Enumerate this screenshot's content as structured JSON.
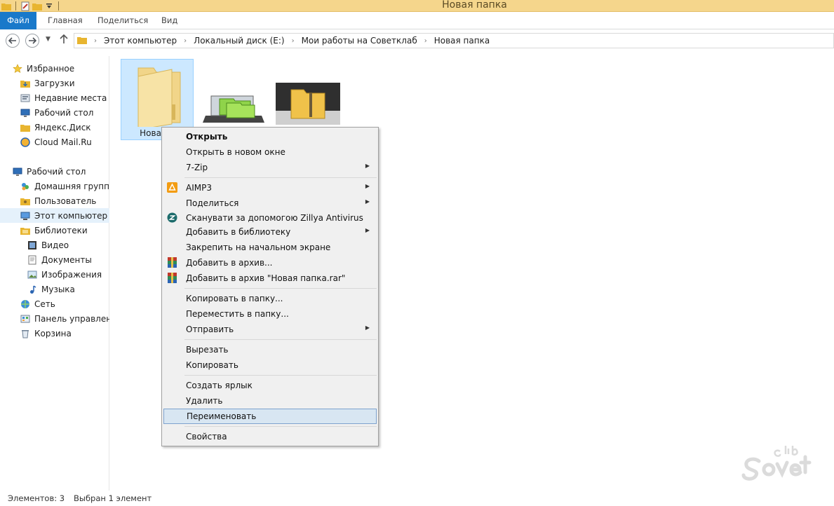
{
  "window": {
    "title": "Новая папка"
  },
  "quick_access": {
    "icons": [
      "folder-icon",
      "properties-icon",
      "new-folder-icon",
      "customize-dropdown-icon"
    ]
  },
  "ribbon": {
    "tabs": [
      "Файл",
      "Главная",
      "Поделиться",
      "Вид"
    ]
  },
  "address_bar": {
    "breadcrumbs": [
      "Этот компьютер",
      "Локальный диск (E:)",
      "Мои работы на Советклаб",
      "Новая папка"
    ]
  },
  "nav_pane": {
    "items": [
      {
        "label": "Избранное",
        "icon": "star-icon"
      },
      {
        "label": "Загрузки",
        "icon": "downloads-icon"
      },
      {
        "label": "Недавние места",
        "icon": "recent-places-icon"
      },
      {
        "label": "Рабочий стол",
        "icon": "desktop-icon"
      },
      {
        "label": "Яндекс.Диск",
        "icon": "yandex-disk-icon"
      },
      {
        "label": "Cloud Mail.Ru",
        "icon": "cloud-mail-icon"
      },
      {
        "label": "Рабочий стол",
        "icon": "desktop-icon"
      },
      {
        "label": "Домашняя группа",
        "icon": "homegroup-icon"
      },
      {
        "label": "Пользователь",
        "icon": "user-folder-icon"
      },
      {
        "label": "Этот компьютер",
        "icon": "computer-icon"
      },
      {
        "label": "Библиотеки",
        "icon": "libraries-icon"
      },
      {
        "label": "Видео",
        "icon": "video-icon"
      },
      {
        "label": "Документы",
        "icon": "documents-icon"
      },
      {
        "label": "Изображения",
        "icon": "pictures-icon"
      },
      {
        "label": "Музыка",
        "icon": "music-icon"
      },
      {
        "label": "Сеть",
        "icon": "network-icon"
      },
      {
        "label": "Панель управления",
        "icon": "control-panel-icon"
      },
      {
        "label": "Корзина",
        "icon": "recycle-bin-icon"
      }
    ]
  },
  "content": {
    "items": [
      {
        "label": "Новая п",
        "kind": "folder",
        "selected": true
      },
      {
        "label": "",
        "kind": "image-thumbnail"
      },
      {
        "label": "",
        "kind": "image-thumbnail"
      }
    ]
  },
  "context_menu": {
    "items": [
      {
        "label": "Открыть",
        "bold": true
      },
      {
        "label": "Открыть в новом окне"
      },
      {
        "label": "7-Zip",
        "submenu": true
      },
      {
        "label": "AIMP3",
        "submenu": true,
        "icon": "aimp-icon"
      },
      {
        "label": "Поделиться",
        "submenu": true
      },
      {
        "label": "Сканувати за допомогою Zillya Antivirus",
        "icon": "zillya-icon"
      },
      {
        "label": "Добавить в библиотеку",
        "submenu": true
      },
      {
        "label": "Закрепить на начальном экране"
      },
      {
        "label": "Добавить в архив...",
        "icon": "winrar-icon"
      },
      {
        "label": "Добавить в архив \"Новая папка.rar\"",
        "icon": "winrar-icon"
      },
      {
        "label": "Копировать в папку..."
      },
      {
        "label": "Переместить в папку..."
      },
      {
        "label": "Отправить",
        "submenu": true
      },
      {
        "label": "Вырезать"
      },
      {
        "label": "Копировать"
      },
      {
        "label": "Создать ярлык"
      },
      {
        "label": "Удалить"
      },
      {
        "label": "Переименовать",
        "highlighted": true
      },
      {
        "label": "Свойства"
      }
    ]
  },
  "status_bar": {
    "count": "Элементов: 3",
    "selection": "Выбран 1 элемент"
  },
  "colors": {
    "title_bar": "#f5d68c",
    "file_tab": "#1979ca",
    "selection": "#cce8ff",
    "menu_highlight": "#d8e6f2"
  }
}
